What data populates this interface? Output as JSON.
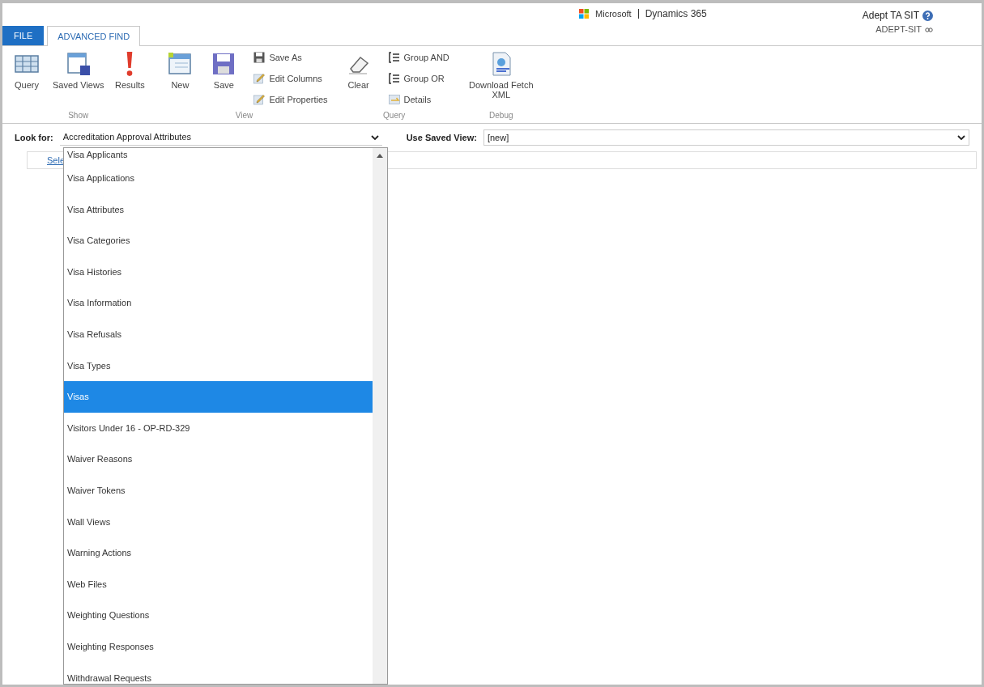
{
  "header": {
    "brand": "Microsoft",
    "product": "Dynamics 365",
    "user": "Adept TA SIT",
    "org": "ADEPT-SIT"
  },
  "tabs": [
    {
      "label": "FILE",
      "selected": false
    },
    {
      "label": "ADVANCED FIND",
      "selected": true
    }
  ],
  "ribbon_groups": [
    {
      "label": "Show",
      "buttons": [
        {
          "kind": "large",
          "label": "Query"
        },
        {
          "kind": "large",
          "label": "Saved Views"
        },
        {
          "kind": "large",
          "label": "Results"
        }
      ]
    },
    {
      "label": "View",
      "buttons": [
        {
          "kind": "large",
          "label": "New"
        },
        {
          "kind": "large",
          "label": "Save"
        },
        {
          "kind": "small",
          "label": "Save As"
        },
        {
          "kind": "small",
          "label": "Edit Columns"
        },
        {
          "kind": "small",
          "label": "Edit Properties"
        }
      ]
    },
    {
      "label": "Query",
      "buttons": [
        {
          "kind": "large",
          "label": "Clear"
        },
        {
          "kind": "small",
          "label": "Group AND"
        },
        {
          "kind": "small",
          "label": "Group OR"
        },
        {
          "kind": "small",
          "label": "Details"
        }
      ]
    },
    {
      "label": "Debug",
      "buttons": [
        {
          "kind": "large",
          "label": "Download Fetch XML"
        }
      ]
    }
  ],
  "look_for": {
    "label": "Look for:",
    "value": "Accreditation Approval Attributes"
  },
  "saved_view": {
    "label": "Use Saved View:",
    "value": "[new]"
  },
  "behind_tab": "Sele",
  "dropdown_items": [
    {
      "label": "Visa Applicants",
      "selected": false
    },
    {
      "label": "Visa Applications",
      "selected": false
    },
    {
      "label": "Visa Attributes",
      "selected": false
    },
    {
      "label": "Visa Categories",
      "selected": false
    },
    {
      "label": "Visa Histories",
      "selected": false
    },
    {
      "label": "Visa Information",
      "selected": false
    },
    {
      "label": "Visa Refusals",
      "selected": false
    },
    {
      "label": "Visa Types",
      "selected": false
    },
    {
      "label": "Visas",
      "selected": true
    },
    {
      "label": "Visitors Under 16 - OP-RD-329",
      "selected": false
    },
    {
      "label": "Waiver Reasons",
      "selected": false
    },
    {
      "label": "Waiver Tokens",
      "selected": false
    },
    {
      "label": "Wall Views",
      "selected": false
    },
    {
      "label": "Warning Actions",
      "selected": false
    },
    {
      "label": "Web Files",
      "selected": false
    },
    {
      "label": "Weighting Questions",
      "selected": false
    },
    {
      "label": "Weighting Responses",
      "selected": false
    },
    {
      "label": "Withdrawal Requests",
      "selected": false
    }
  ]
}
